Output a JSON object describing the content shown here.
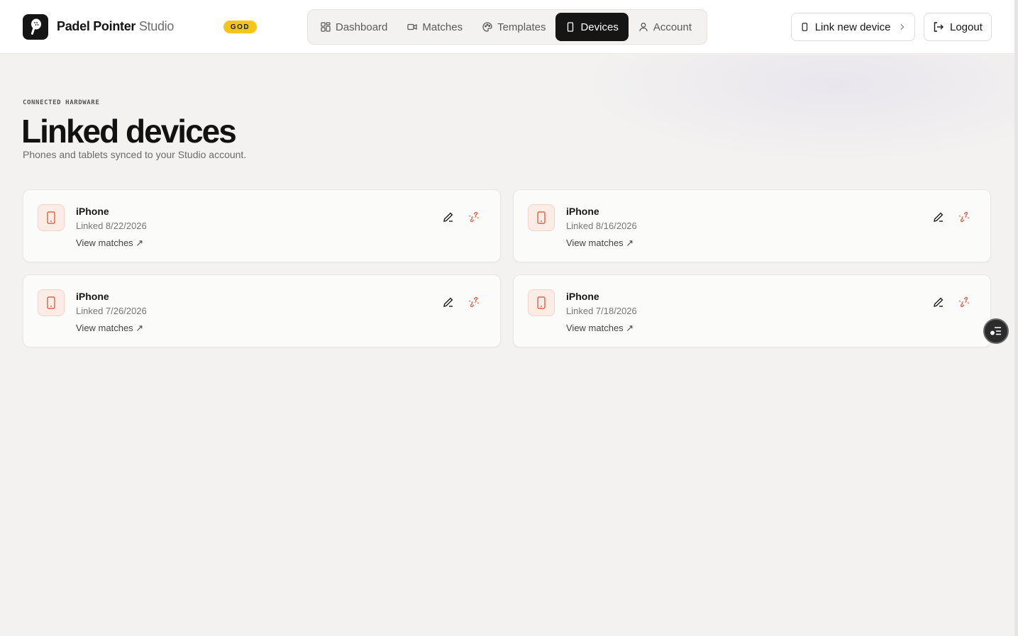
{
  "header": {
    "brand_bold": "Padel Pointer",
    "brand_light": " Studio",
    "badge": "GOD",
    "nav": [
      {
        "label": "Dashboard",
        "icon": "grid-icon"
      },
      {
        "label": "Matches",
        "icon": "video-icon"
      },
      {
        "label": "Templates",
        "icon": "palette-icon"
      },
      {
        "label": "Devices",
        "icon": "phone-icon",
        "active": true
      },
      {
        "label": "Account",
        "icon": "user-icon"
      }
    ],
    "link_device_label": "Link new device",
    "logout_label": "Logout"
  },
  "page": {
    "eyebrow": "CONNECTED HARDWARE",
    "title": "Linked devices",
    "subtitle": "Phones and tablets synced to your Studio account."
  },
  "devices": [
    {
      "name": "iPhone",
      "linked": "Linked 8/22/2026",
      "link": "View matches ↗"
    },
    {
      "name": "iPhone",
      "linked": "Linked 8/16/2026",
      "link": "View matches ↗"
    },
    {
      "name": "iPhone",
      "linked": "Linked 7/26/2026",
      "link": "View matches ↗"
    },
    {
      "name": "iPhone",
      "linked": "Linked 7/18/2026",
      "link": "View matches ↗"
    }
  ],
  "colors": {
    "accent": "#151515",
    "badge": "#f5c518",
    "danger": "#d9654a",
    "background": "#f3f2f0"
  }
}
